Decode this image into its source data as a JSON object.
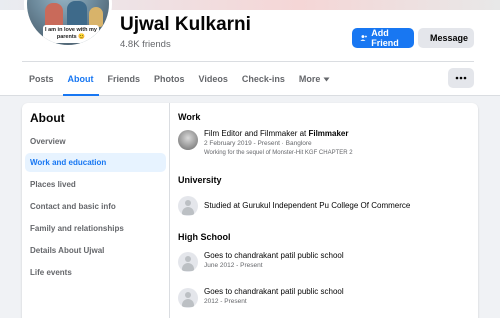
{
  "profile": {
    "name": "Ujwal Kulkarni",
    "friends": "4.8K friends",
    "avatar_caption": "I am in love with my parents 😊"
  },
  "actions": {
    "add_friend": "Add Friend",
    "message": "Message"
  },
  "nav": {
    "items": [
      "Posts",
      "About",
      "Friends",
      "Photos",
      "Videos",
      "Check-ins",
      "More"
    ],
    "active": "About"
  },
  "about": {
    "title": "About",
    "menu": [
      "Overview",
      "Work and education",
      "Places lived",
      "Contact and basic info",
      "Family and relationships",
      "Details About Ujwal",
      "Life events"
    ],
    "active": "Work and education"
  },
  "work": {
    "title": "Work",
    "role_prefix": "Film Editor and Filmmaker at ",
    "employer": "Filmmaker",
    "dates": "2 February 2019 - Present · Banglore",
    "note": "Working for the sequel of Monster-Hit KGF CHAPTER 2"
  },
  "university": {
    "title": "University",
    "text": "Studied at Gurukul Independent Pu College Of Commerce"
  },
  "high_school": {
    "title": "High School",
    "entries": [
      {
        "text": "Goes to chandrakant patil public school",
        "dates": "June 2012 - Present"
      },
      {
        "text": "Goes to chandrakant patil public school",
        "dates": "2012 - Present"
      }
    ]
  },
  "colors": {
    "accent": "#1877f2",
    "active_bg": "#e7f3ff",
    "page_bg": "#f0f2f5"
  }
}
